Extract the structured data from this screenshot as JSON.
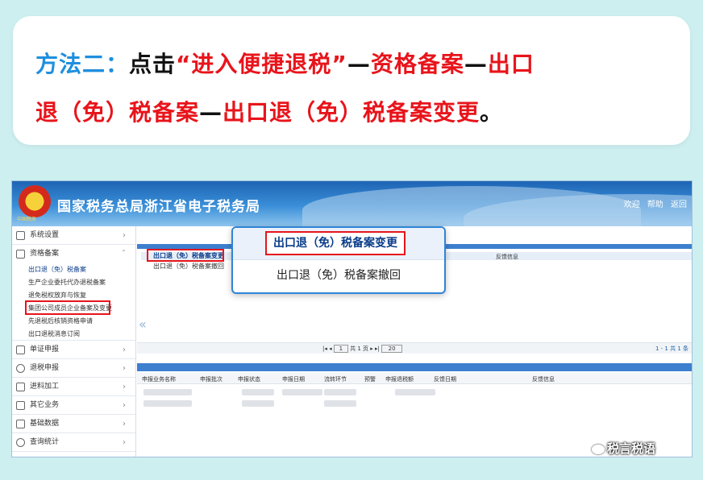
{
  "instruction": {
    "label": "方法二：",
    "verb": "点击",
    "quote": "“进入便捷退税”",
    "sep1": "—",
    "step1": "资格备案",
    "sep2": "—",
    "step2a": "出口",
    "step2b": "退（免）税备案",
    "sep3": "—",
    "step3": "出口退（免）税备案变更",
    "end": "。"
  },
  "header": {
    "site_title": "国家税务总局浙江省电子税务局",
    "emblem_caption": "中国税务",
    "welcome": "欢迎",
    "help": "帮助",
    "back": "返回"
  },
  "sidebar": {
    "items": [
      {
        "label": "系统设置"
      },
      {
        "label": "资格备案"
      },
      {
        "label": "单证申报"
      },
      {
        "label": "退税申报"
      },
      {
        "label": "进料加工"
      },
      {
        "label": "其它业务"
      },
      {
        "label": "基础数据"
      },
      {
        "label": "查询统计"
      }
    ],
    "subitems": [
      "出口退（免）税备案",
      "生产企业委托代办退税备案",
      "退免税权放弃与恢复",
      "集团公司成员企业备案及变更",
      "先退税后核销资格申请",
      "出口退税消息订阅"
    ]
  },
  "main": {
    "mini_menu": [
      "出口退（免）税备案变更",
      "出口退（免）税备案撤回"
    ],
    "feedback_col": "反馈信息",
    "pager": {
      "page": "1",
      "total": "共 1 页",
      "size": "20",
      "range": "1 - 1  共 1 条"
    },
    "lower_columns": [
      "申报业务名称",
      "申报批次",
      "申报状态",
      "申报日期",
      "流转环节",
      "预警",
      "申报退税额",
      "反馈日期",
      "反馈信息"
    ]
  },
  "popup": {
    "option1": "出口退（免）税备案变更",
    "option2": "出口退（免）税备案撤回"
  },
  "watermark": "税言税语",
  "colors": {
    "accent_blue": "#1f8fde",
    "accent_red": "#e8141b",
    "banner": "#1e64b4"
  }
}
